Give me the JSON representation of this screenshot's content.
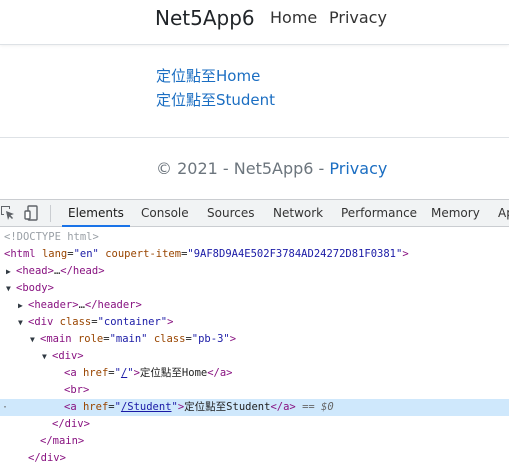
{
  "page": {
    "brand": "Net5App6",
    "nav": {
      "home": "Home",
      "privacy": "Privacy"
    },
    "links": [
      "定位點至Home",
      "定位點至Student"
    ],
    "footer": {
      "text": "© 2021 - Net5App6 - ",
      "privacy_link": "Privacy"
    }
  },
  "devtools": {
    "tabs": [
      "Elements",
      "Console",
      "Sources",
      "Network",
      "Performance",
      "Memory",
      "Ap"
    ],
    "active_tab": "Elements",
    "tree": {
      "doctype": "<!DOCTYPE html>",
      "html_tag": "html",
      "html_lang_attr": "lang",
      "html_lang_val": "\"en\"",
      "html_coupert_attr": "coupert-item",
      "html_coupert_val": "\"9AF8D9A4E502F3784AD24272D81F0381\"",
      "head_open": "<head>",
      "ellipsis": "…",
      "head_close": "</head>",
      "body_open": "<body>",
      "header_open": "<header>",
      "header_close": "</header>",
      "div_tag": "div",
      "class_attr": "class",
      "container_val": "\"container\"",
      "main_tag": "main",
      "role_attr": "role",
      "role_val": "\"main\"",
      "pb3_val": "\"pb-3\"",
      "div_open": "<div>",
      "a_tag": "a",
      "href_attr": "href",
      "href_home": "/",
      "home_text": "定位點至Home",
      "a_close": "</a>",
      "br_tag": "<br>",
      "href_student": "/Student",
      "student_text": "定位點至Student",
      "selected_marker": "== $0",
      "div_close": "</div>",
      "main_close": "</main>",
      "div_close2": "</div>"
    }
  },
  "colors": {
    "link": "#1b6ec2",
    "tag": "#881280",
    "attr_name": "#994500",
    "attr_value": "#1a1aa6",
    "selection": "#cfe8fc",
    "active_tab_underline": "#1a73e8"
  }
}
